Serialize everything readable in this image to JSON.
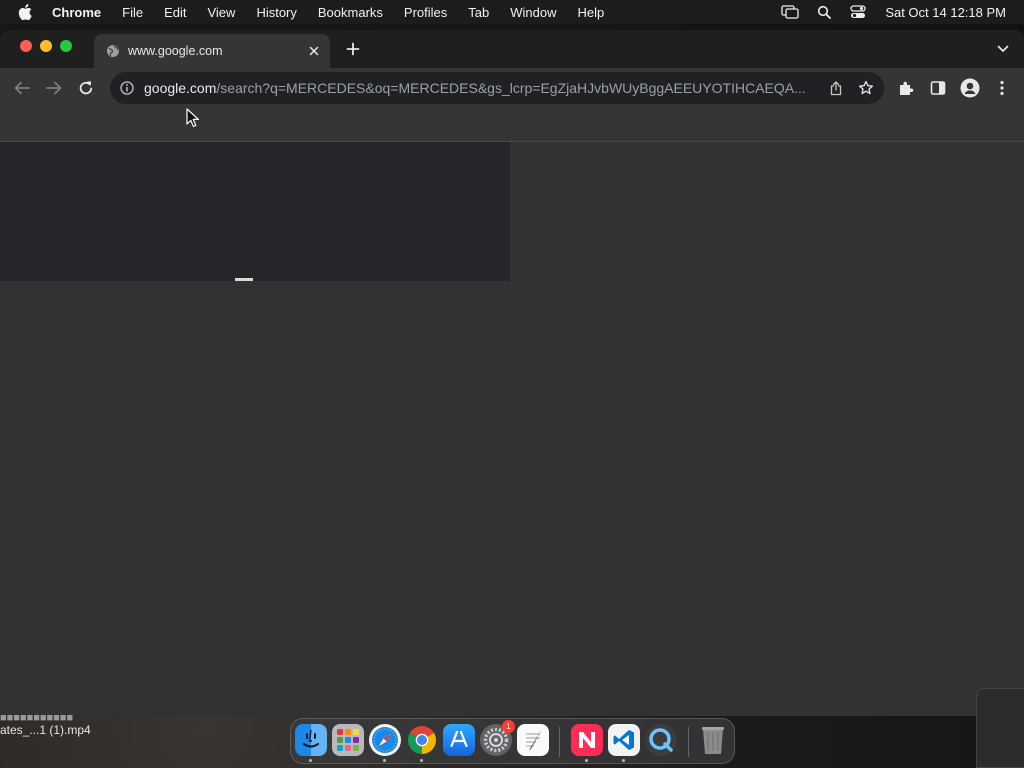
{
  "menubar": {
    "app_name": "Chrome",
    "items": [
      "File",
      "Edit",
      "View",
      "History",
      "Bookmarks",
      "Profiles",
      "Tab",
      "Window",
      "Help"
    ],
    "clock": "Sat Oct 14  12:18 PM"
  },
  "browser": {
    "tab_title": "www.google.com",
    "url_domain": "google.com",
    "url_path": "/search?q=MERCEDES&oq=MERCEDES&gs_lcrp=EgZjaHJvbWUyBggAEEUYOTIHCAEQA..."
  },
  "desktop": {
    "file_name_partial": "ates_...1 (1).mp4"
  },
  "dock": {
    "items": [
      "Finder",
      "Launchpad",
      "Safari",
      "Google Chrome",
      "App Store",
      "System Settings",
      "TextEdit",
      "News",
      "Visual Studio Code",
      "QuickTime Player",
      "Trash"
    ],
    "settings_badge": "1"
  },
  "colors": {
    "window_bg": "#353535",
    "tabstrip_bg": "#1f1f1f",
    "omnibox_bg": "#202124",
    "traffic_close": "#ff5f57",
    "traffic_min": "#febc2e",
    "traffic_max": "#28c840"
  }
}
